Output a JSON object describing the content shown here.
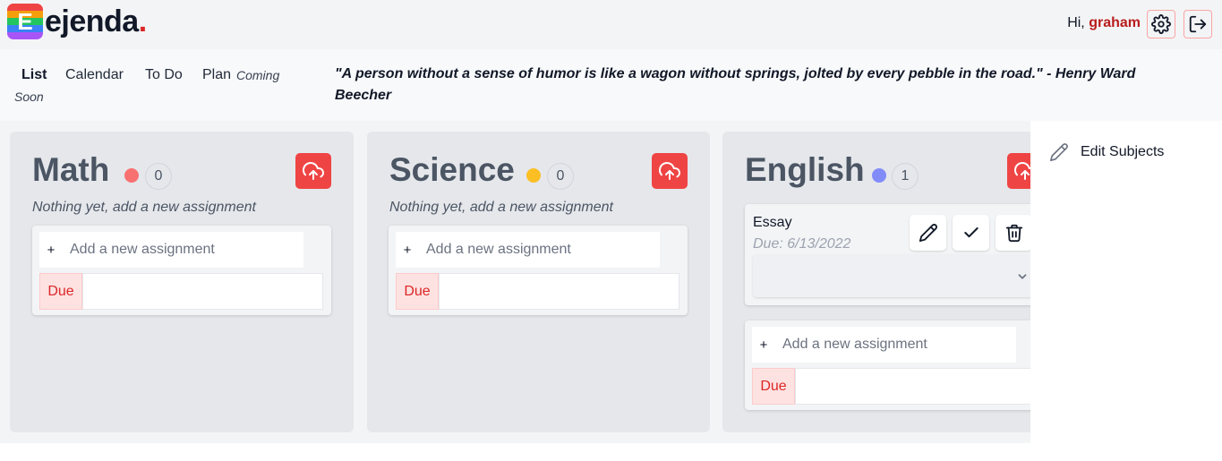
{
  "app": {
    "logo_letter": "E",
    "name": "ejenda",
    "name_dot": ".",
    "logo_stripes": [
      "#ef4444",
      "#f59e0b",
      "#22c55e",
      "#3b82f6",
      "#a855f7"
    ]
  },
  "header": {
    "greeting": "Hi,",
    "username": "graham",
    "settings_icon": "gear-icon",
    "logout_icon": "logout-icon"
  },
  "nav": {
    "items": [
      {
        "label": "List",
        "active": true
      },
      {
        "label": "Calendar",
        "active": false
      },
      {
        "label": "To Do",
        "active": false
      },
      {
        "label": "Plan",
        "active": false
      }
    ],
    "coming": "Coming",
    "soon": "Soon",
    "quote": "\"A person without a sense of humor is like a wagon without springs, jolted by every pebble in the road.\" - Henry Ward Beecher"
  },
  "columns": [
    {
      "name": "Math",
      "color": "#f87171",
      "count": "0",
      "empty_message": "Nothing yet, add a new assignment",
      "add_placeholder": "Add a new assignment",
      "due_label": "Due"
    },
    {
      "name": "Science",
      "color": "#fbbf24",
      "count": "0",
      "empty_message": "Nothing yet, add a new assignment",
      "add_placeholder": "Add a new assignment",
      "due_label": "Due"
    },
    {
      "name": "English",
      "color": "#818cf8",
      "count": "1",
      "tasks": [
        {
          "name": "Essay",
          "due": "Due: 6/13/2022"
        }
      ],
      "add_placeholder": "Add a new assignment",
      "due_label": "Due"
    }
  ],
  "add_symbol": "+",
  "side_panel": {
    "edit_label": "Edit Subjects",
    "edit_icon": "pencil-icon"
  },
  "colors": {
    "accent_red": "#ef4444",
    "username_red": "#b91c1c"
  }
}
